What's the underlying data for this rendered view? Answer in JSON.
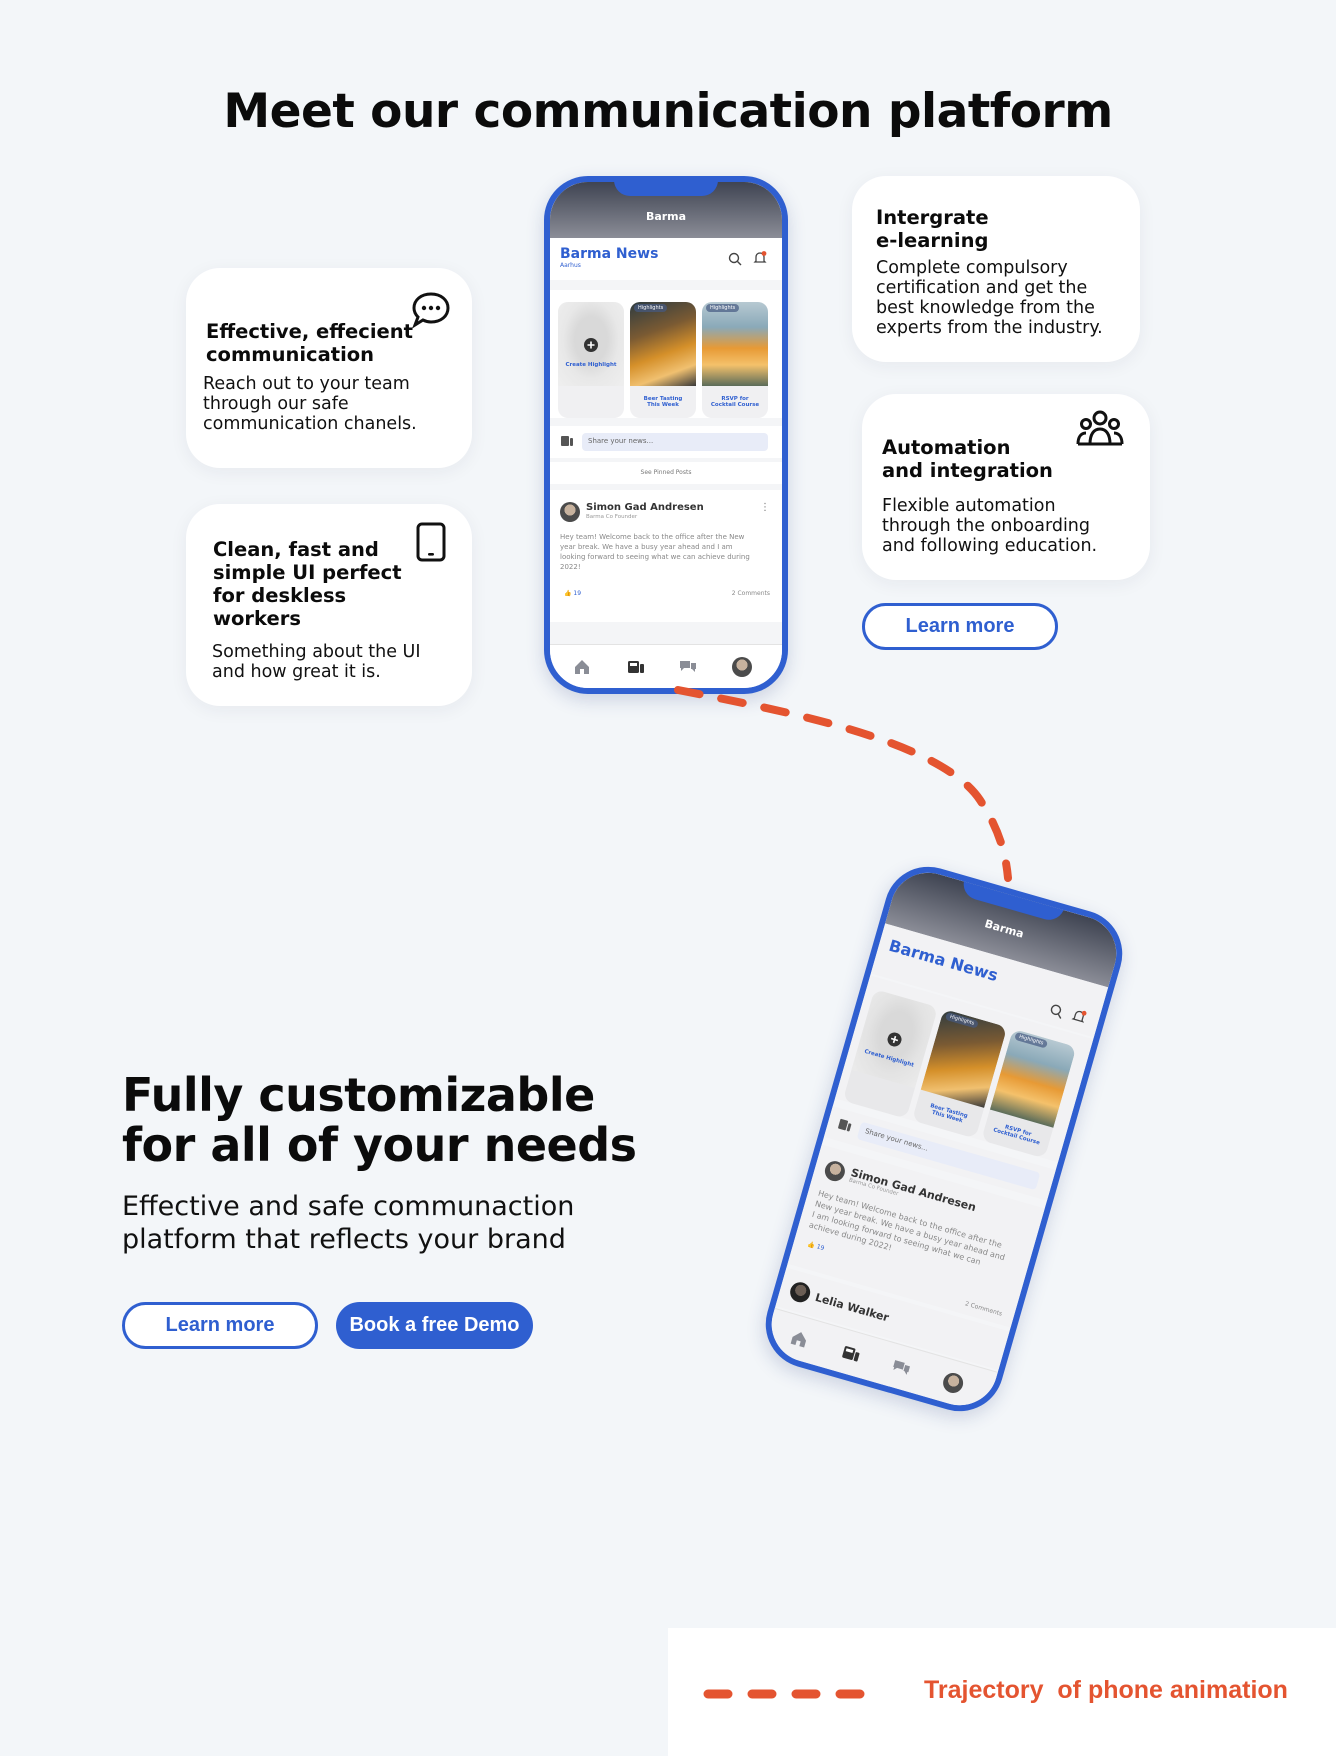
{
  "heading": "Meet our communication platform",
  "cards": {
    "communication": {
      "title": "Effective, effecient\ncommunication",
      "body": "Reach out to your team\nthrough our safe\ncommunication chanels.",
      "icon": "chat-bubble-icon"
    },
    "ui": {
      "title": "Clean, fast and\nsimple UI perfect\nfor deskless\nworkers",
      "body": "Something about the UI\nand how great it is.",
      "icon": "tablet-icon"
    },
    "elearning": {
      "title": "Intergrate\ne-learning",
      "body": "Complete compulsory\ncertification and get the\nbest knowledge from the\nexperts from the industry."
    },
    "automation": {
      "title": "Automation\nand integration",
      "body": "Flexible automation\nthrough the onboarding\nand following education.",
      "icon": "team-icon"
    }
  },
  "top_learn_more": "Learn more",
  "phone": {
    "brand": "Barma",
    "title": "Barma News",
    "location": "Aarhus",
    "highlights": [
      {
        "tag": "",
        "label": "Create Highlight"
      },
      {
        "tag": "Highlights",
        "label": "Beer Tasting\nThis Week"
      },
      {
        "tag": "Highlights",
        "label": "RSVP for\nCocktail Course"
      }
    ],
    "share_placeholder": "Share your news...",
    "pinned": "See Pinned Posts",
    "post": {
      "author": "Simon Gad Andresen",
      "role": "Barma Co Founder",
      "text": "Hey team! Welcome back to the office after the New year break. We have a busy year ahead and I am looking forward to seeing what we can achieve during 2022!",
      "likes": "19",
      "comments": "2 Comments"
    },
    "next_author": "Lelia Walker"
  },
  "section2": {
    "heading": "Fully customizable\nfor all of your needs",
    "subheading": "Effective and safe communaction\nplatform that reflects your brand",
    "learn_more": "Learn more",
    "demo": "Book a free Demo"
  },
  "legend": "Trajectory  of phone animation",
  "colors": {
    "accent": "#2f5fd0",
    "trajectory": "#e45430",
    "background": "#f3f6f9"
  }
}
